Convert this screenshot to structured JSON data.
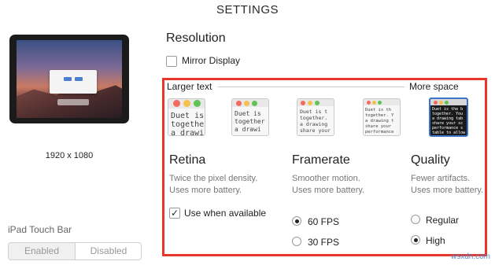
{
  "window": {
    "title": "SETTINGS"
  },
  "device_preview": {
    "resolution_label": "1920 x 1080"
  },
  "touch_bar": {
    "label": "iPad Touch Bar",
    "options": [
      "Enabled",
      "Disabled"
    ],
    "selected": "Disabled"
  },
  "resolution": {
    "heading": "Resolution",
    "mirror_display": {
      "label": "Mirror Display",
      "checked": false
    },
    "slider": {
      "left_label": "Larger text",
      "right_label": "More space",
      "selected_index": 4,
      "thumbnails": [
        {
          "lines": [
            "Duet is",
            "together",
            "a drawi"
          ]
        },
        {
          "lines": [
            "Duet is",
            "together",
            "a drawi"
          ]
        },
        {
          "lines": [
            "Duet is t",
            "together.",
            "a drawing",
            "share your"
          ]
        },
        {
          "lines": [
            "Duet is th",
            "together. Y",
            "a drawing t",
            "share your",
            "performance"
          ]
        },
        {
          "lines": [
            "Duet is the b",
            "together. You",
            "a drawing tab",
            "share your sc",
            "performance s",
            "table to allow"
          ]
        }
      ]
    }
  },
  "modes": {
    "retina": {
      "title": "Retina",
      "desc_line1": "Twice the pixel density.",
      "desc_line2": "Uses more battery.",
      "checkbox_label": "Use when available",
      "checked": true
    },
    "framerate": {
      "title": "Framerate",
      "desc_line1": "Smoother motion.",
      "desc_line2": "Uses more battery.",
      "options": [
        "60 FPS",
        "30 FPS"
      ],
      "selected": "60 FPS"
    },
    "quality": {
      "title": "Quality",
      "desc_line1": "Fewer artifacts.",
      "desc_line2": "Uses more battery.",
      "options": [
        "Regular",
        "High"
      ],
      "selected": "High"
    }
  },
  "watermark": "wsxdn.com",
  "colors": {
    "highlight_box": "#e8372a",
    "selected_thumbnail": "#3b74c6",
    "traffic_red": "#f46a5e",
    "traffic_yellow": "#f6c04f",
    "traffic_green": "#5fc453"
  }
}
